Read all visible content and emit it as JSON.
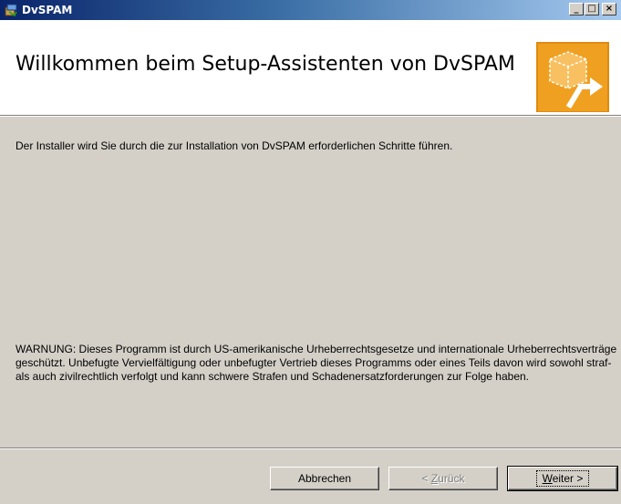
{
  "window": {
    "title": "DvSPAM",
    "app_icon": "installer-package-icon",
    "controls": {
      "minimize": "_",
      "maximize": "□",
      "close": "×"
    }
  },
  "header": {
    "heading": "Willkommen beim Setup-Assistenten von DvSPAM",
    "artwork_icon": "box-arrow-icon",
    "accent_color": "#f0a020"
  },
  "body": {
    "intro": "Der Installer wird Sie durch die zur Installation von DvSPAM erforderlichen Schritte führen.",
    "warning": "WARNUNG: Dieses Programm ist durch US-amerikanische Urheberrechtsgesetze und internationale Urheberrechtsverträge geschützt. Unbefugte Vervielfältigung oder unbefugter Vertrieb dieses Programms oder eines Teils davon wird sowohl straf- als auch zivilrechtlich verfolgt und kann schwere Strafen und Schadenersatzforderungen zur Folge haben."
  },
  "buttons": {
    "cancel": {
      "label": "Abbrechen"
    },
    "back": {
      "prefix": "< ",
      "mnemonic": "Z",
      "rest": "urück",
      "enabled": false
    },
    "next": {
      "mnemonic": "W",
      "rest": "eiter >",
      "default": true
    }
  }
}
